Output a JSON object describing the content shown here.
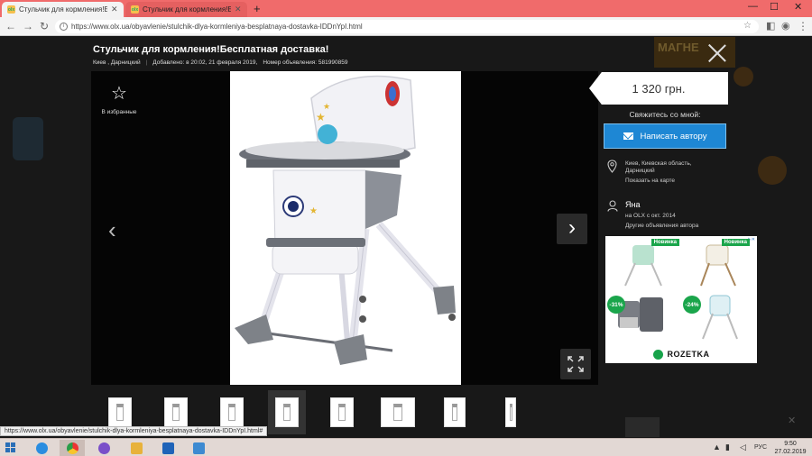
{
  "browser": {
    "tabs": [
      {
        "title": "Стульчик для кормления!Бесплатная"
      },
      {
        "title": "Стульчик для кормления!Бесплатная"
      }
    ],
    "url": "https://www.olx.ua/obyavlenie/stulchik-dlya-kormleniya-besplatnaya-dostavka-IDDnYpI.html",
    "status_url": "https://www.olx.ua/obyavlenie/stulchik-dlya-kormleniya-besplatnaya-dostavka-IDDnYpI.html#"
  },
  "listing": {
    "title": "Стульчик для кормления!Бесплатная доставка!",
    "location": "Киев , Дарницкий",
    "added": "Добавлено: в 20:02, 21 февраля 2019,",
    "ad_number": "Номер объявления: 581990859",
    "favorite_label": "В избранные",
    "price": "1 320 грн.",
    "contact_label": "Свяжитесь со мной:",
    "write_button": "Написать автору",
    "address_line1": "Киев, Киевская область,",
    "address_line2": "Дарницкий",
    "map_link": "Показать на карте",
    "seller_name": "Яна",
    "seller_since": "на OLX с окт. 2014",
    "other_ads": "Другие объявления автора"
  },
  "ad": {
    "badge_new": "Новинка",
    "discount_1": "-31%",
    "discount_2": "-24%",
    "brand": "ROZETKA"
  },
  "background_ad": {
    "text": "МАГНЕ"
  },
  "taskbar": {
    "language": "РУС",
    "time": "9:50",
    "date": "27.02.2019"
  },
  "colors": {
    "brand_tab": "#f06b6b",
    "button_blue": "#1e87d4",
    "badge_green": "#1aa54b"
  }
}
